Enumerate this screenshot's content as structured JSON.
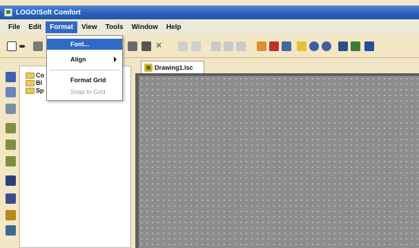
{
  "window": {
    "title": "LOGO!Soft Comfort"
  },
  "menubar": {
    "items": [
      {
        "label": "File"
      },
      {
        "label": "Edit"
      },
      {
        "label": "Format"
      },
      {
        "label": "View"
      },
      {
        "label": "Tools"
      },
      {
        "label": "Window"
      },
      {
        "label": "Help"
      }
    ],
    "active": "Format"
  },
  "format_menu": {
    "items": [
      {
        "label": "Font...",
        "state": "highlighted"
      },
      {
        "label": "Align",
        "submenu": true
      },
      {
        "label": "Format Grid"
      },
      {
        "label": "Snap to Grid",
        "state": "disabled"
      }
    ]
  },
  "tree": {
    "items": [
      {
        "label": "Co"
      },
      {
        "label": "Bl"
      },
      {
        "label": "Sp"
      }
    ]
  },
  "editor": {
    "tab_label": "Drawing1.lsc"
  },
  "colors": {
    "titlebar": "#2a5fb8",
    "menu_highlight": "#3169c6",
    "canvas": "#8d8d8d",
    "background": "#f3e6c4"
  }
}
